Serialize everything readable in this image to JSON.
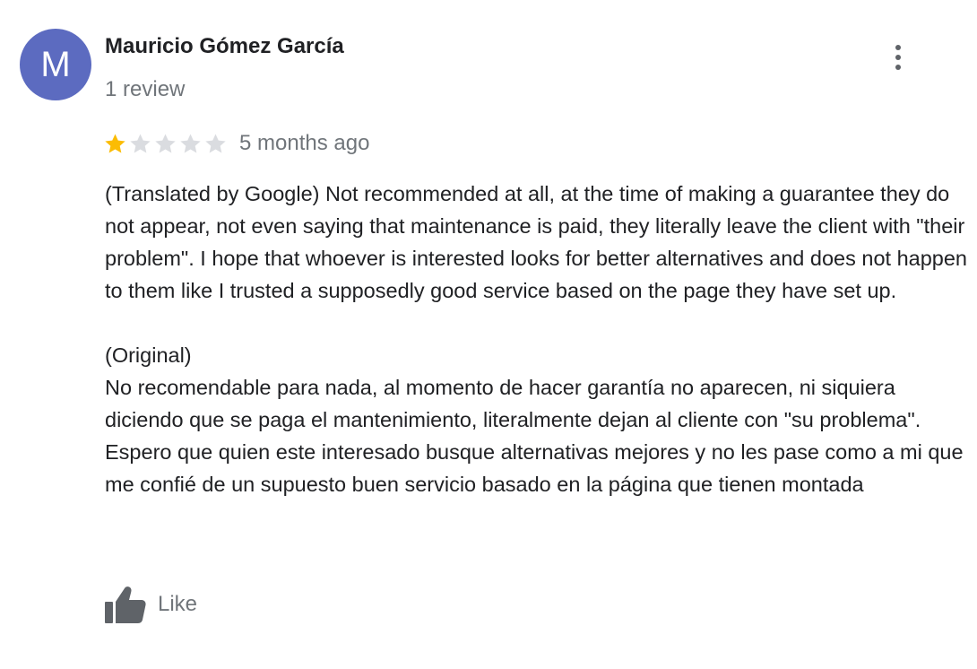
{
  "review": {
    "author": {
      "name": "Mauricio Gómez García",
      "initial": "M",
      "avatar_color": "#5c6bc0",
      "review_count": "1 review"
    },
    "rating": {
      "value": 1,
      "max": 5,
      "filled_color": "#fbbc04",
      "empty_color": "#dadce0"
    },
    "date": "5 months ago",
    "translated_text": "(Translated by Google) Not recommended at all, at the time of making a guarantee they do not appear, not even saying that maintenance is paid, they literally leave the client with \"their problem\". I hope that whoever is interested looks for better alternatives and does not happen to them like I trusted a supposedly good service based on the page they have set up.",
    "original_label": "(Original)",
    "original_text": "No recomendable para nada, al momento de hacer garantía no aparecen, ni siquiera diciendo que se paga el mantenimiento, literalmente dejan al cliente con \"su problema\". Espero que quien este interesado busque alternativas mejores y no les pase como a mi que me confié de un supuesto buen servicio basado en la página que tienen montada",
    "actions": {
      "like_label": "Like",
      "more_icon": "more-vert-icon",
      "like_icon": "thumb-up-icon"
    }
  }
}
